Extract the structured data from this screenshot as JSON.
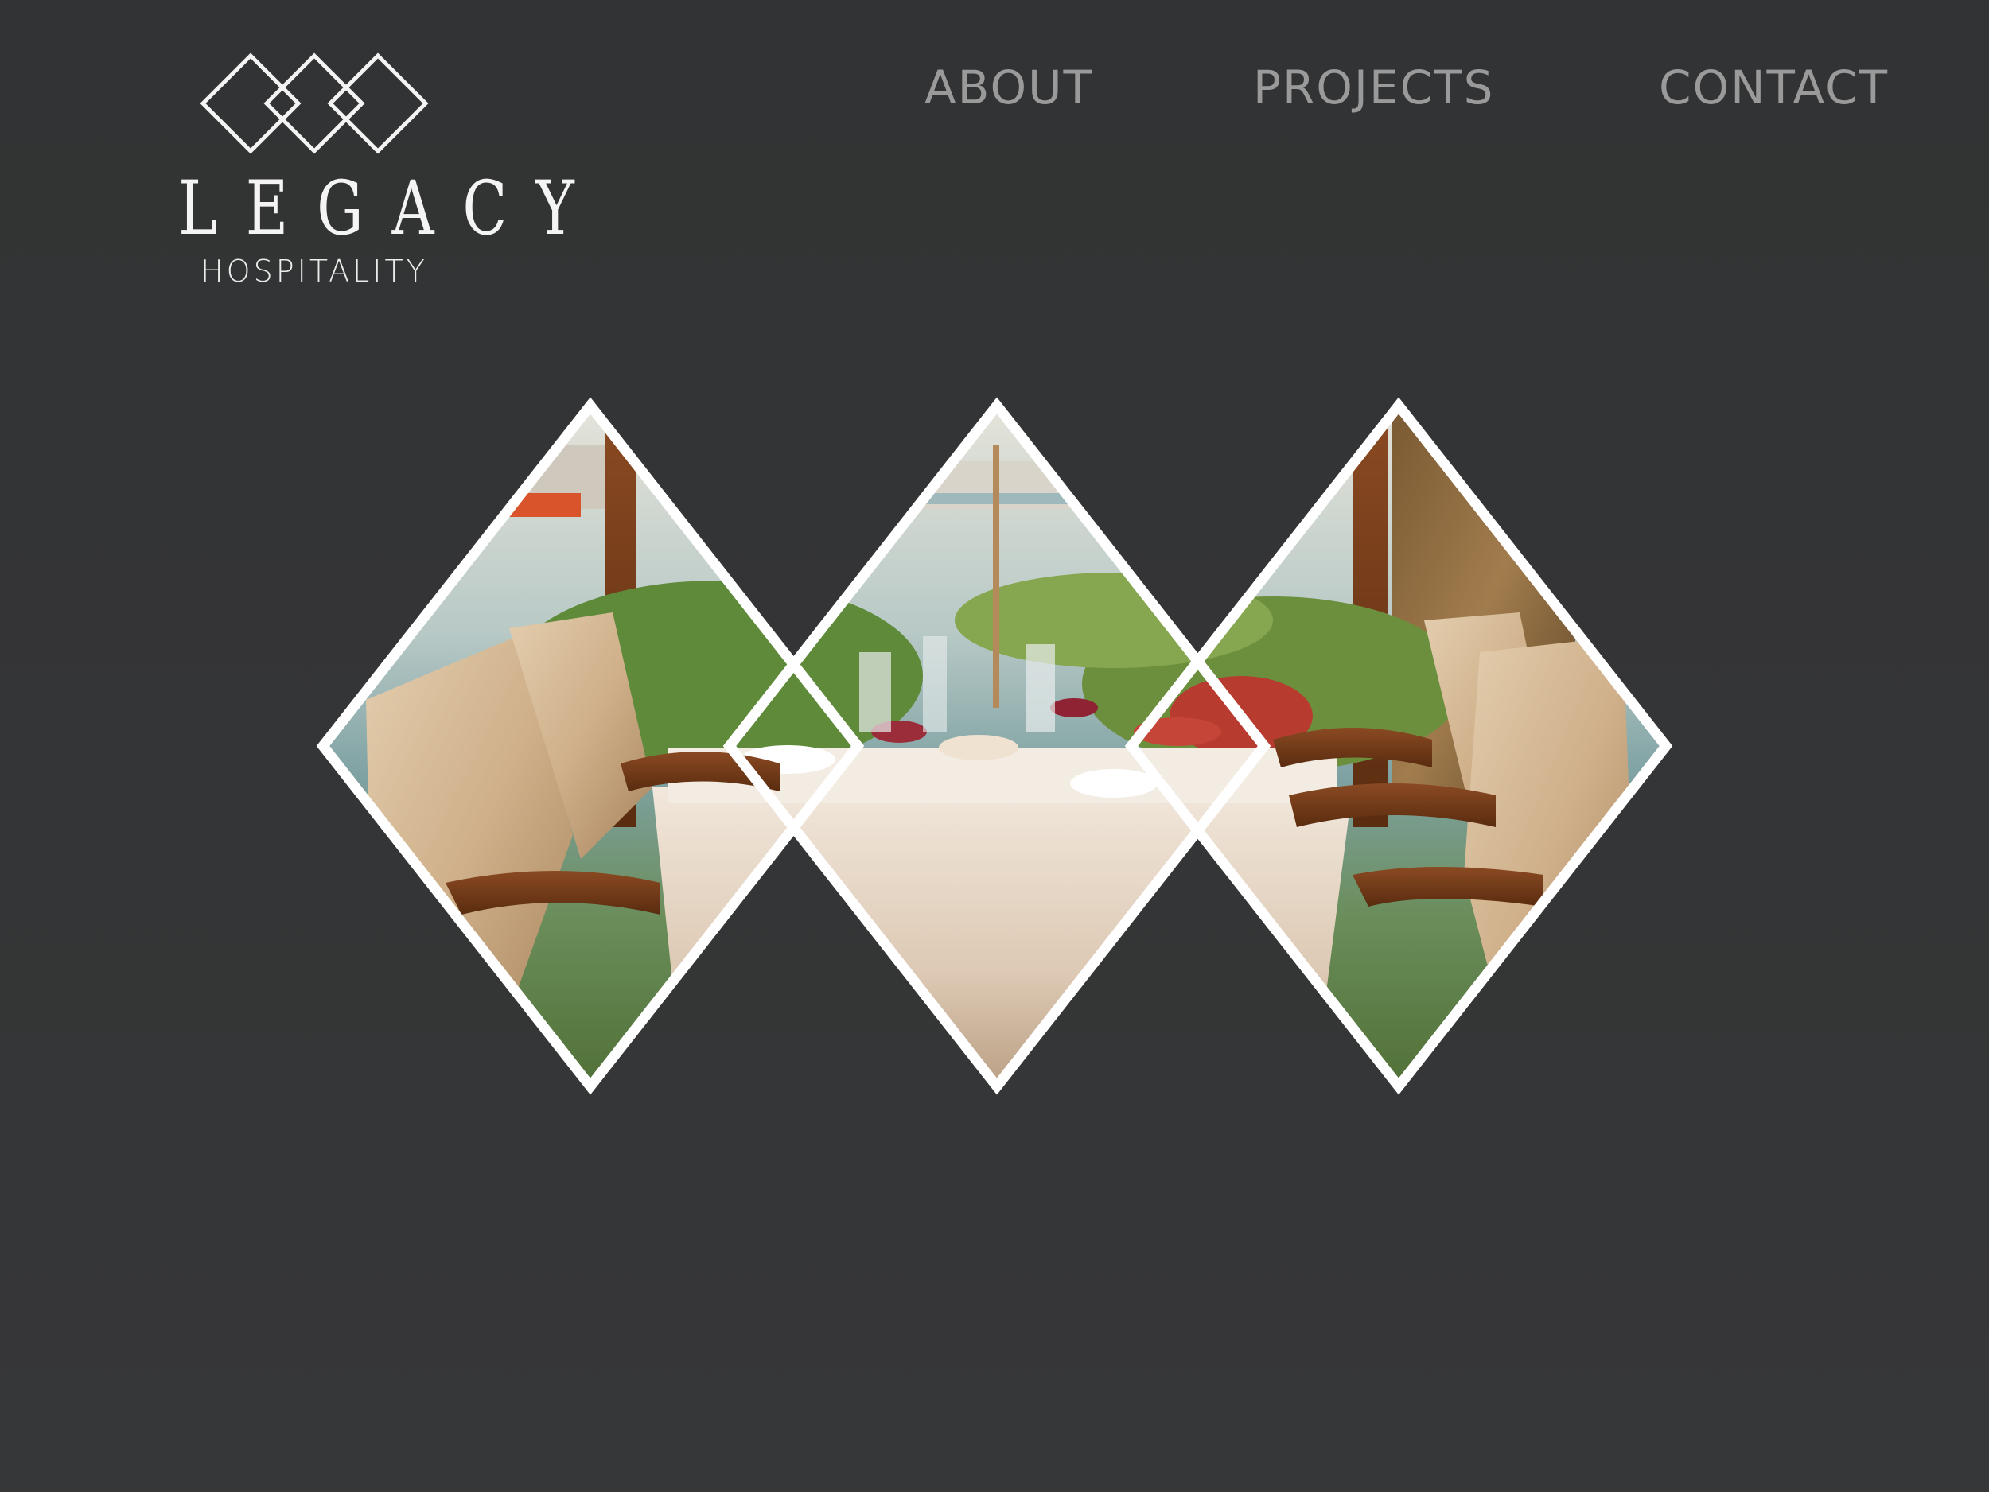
{
  "brand": {
    "name": "LEGACY",
    "tagline": "HOSPITALITY"
  },
  "nav": {
    "items": [
      {
        "label": "ABOUT"
      },
      {
        "label": "PROJECTS"
      },
      {
        "label": "CONTACT"
      }
    ]
  },
  "hero": {
    "image_subject": "restaurant dining table with upholstered armchairs overlooking a marina",
    "frame_count": 3
  },
  "colors": {
    "background": "#333435",
    "nav_text": "#9a9a9a",
    "logo": "#f4f4f4",
    "frame_stroke": "#ffffff"
  },
  "icons": {
    "logo_mark": "three-interlocking-diamonds-icon"
  }
}
